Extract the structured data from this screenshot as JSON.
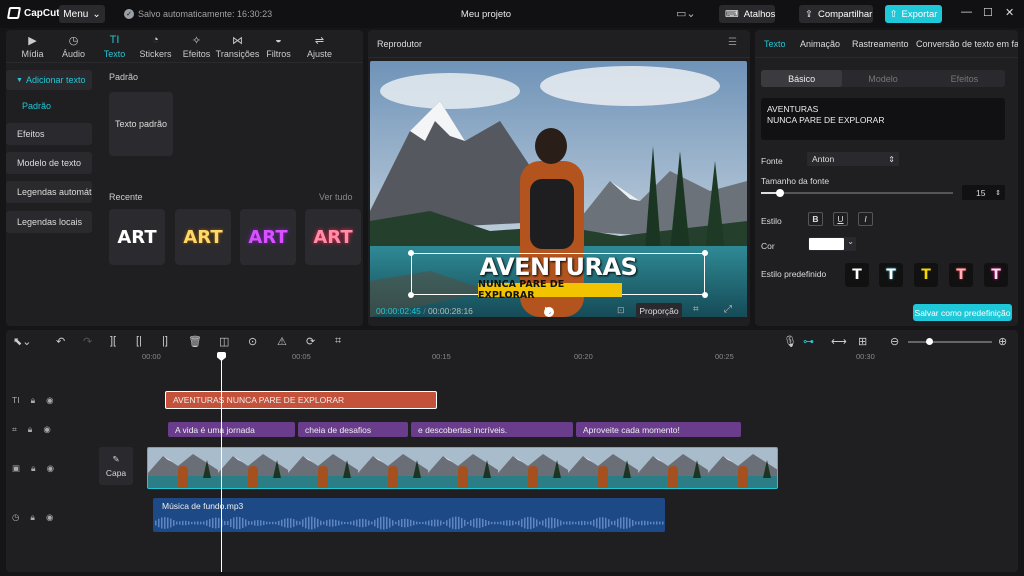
{
  "app": {
    "logo_text": "CapCut",
    "menu_label": "Menu",
    "autosave": "Salvo automaticamente: 16:30:23",
    "project_title": "Meu projeto",
    "shortcuts_label": "Atalhos",
    "share_label": "Compartilhar",
    "export_label": "Exportar"
  },
  "left_tabs": [
    {
      "label": "Mídia",
      "icon": "media-icon"
    },
    {
      "label": "Áudio",
      "icon": "audio-icon"
    },
    {
      "label": "Texto",
      "icon": "text-icon"
    },
    {
      "label": "Stickers",
      "icon": "stickers-icon"
    },
    {
      "label": "Efeitos",
      "icon": "effects-icon"
    },
    {
      "label": "Transições",
      "icon": "transitions-icon"
    },
    {
      "label": "Filtros",
      "icon": "filters-icon"
    },
    {
      "label": "Ajuste",
      "icon": "adjust-icon"
    }
  ],
  "sidebar": {
    "add_text": "Adicionar texto",
    "default": "Padrão",
    "items": [
      "Efeitos",
      "Modelo de texto",
      "Legendas automát",
      "Legendas locais"
    ]
  },
  "text_library": {
    "default_section": "Padrão",
    "default_card": "Texto padrão",
    "recent_section": "Recente",
    "see_all": "Ver tudo",
    "art_label": "ART"
  },
  "player": {
    "title": "Reprodutor",
    "headline": "AVENTURAS",
    "subline": "NUNCA PARE DE EXPLORAR",
    "current_time": "00:00:02:45",
    "total_time": "00:00:28:16",
    "ratio_label": "Proporção"
  },
  "right_panel": {
    "tabs": [
      "Texto",
      "Animação",
      "Rastreamento",
      "Conversão de texto em fala"
    ],
    "segments": [
      "Básico",
      "Modelo",
      "Efeitos"
    ],
    "text_line1": "AVENTURAS",
    "text_line2": "NUNCA PARE DE EXPLORAR",
    "font_label": "Fonte",
    "font_value": "Anton",
    "size_label": "Tamanho da fonte",
    "size_value": "15",
    "size_fraction": 0.1,
    "style_label": "Estilo",
    "color_label": "Cor",
    "preset_label": "Estilo predefinido",
    "save_preset": "Salvar como predefinição"
  },
  "timeline": {
    "ticks": [
      "00:00",
      "00:05",
      "00:15",
      "00:20",
      "00:25",
      "00:30"
    ],
    "title_clip": "AVENTURAS  NUNCA PARE DE EXPLORAR",
    "caption_clips": [
      "A vida é uma jornada",
      "cheia de desafios",
      "e descobertas incríveis.",
      "Aproveite cada momento!"
    ],
    "cover_label": "Capa",
    "audio_clip": "Música de fundo.mp3"
  },
  "colors": {
    "accent": "#1fc8d8",
    "title_clip": "#c4523a",
    "caption_clip": "#6a3d8c",
    "audio_clip": "#1d4a86"
  }
}
